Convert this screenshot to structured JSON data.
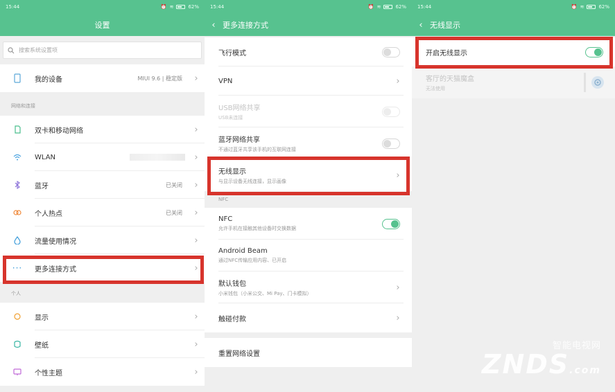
{
  "status": {
    "time": "15:44",
    "battery": "62%"
  },
  "screen1": {
    "title": "设置",
    "search_placeholder": "搜索系统设置项",
    "my_device": {
      "label": "我的设备",
      "value": "MIUI 9.6 | 稳定版"
    },
    "section_network": "网络和连接",
    "network_items": [
      {
        "label": "双卡和移动网络",
        "value": ""
      },
      {
        "label": "WLAN",
        "value": ""
      },
      {
        "label": "蓝牙",
        "value": "已关闭"
      },
      {
        "label": "个人热点",
        "value": "已关闭"
      },
      {
        "label": "流量使用情况",
        "value": ""
      },
      {
        "label": "更多连接方式",
        "value": ""
      }
    ],
    "section_personal": "个人",
    "personal_items": [
      {
        "label": "显示"
      },
      {
        "label": "壁纸"
      },
      {
        "label": "个性主题"
      }
    ]
  },
  "screen2": {
    "title": "更多连接方式",
    "items_top": [
      {
        "title": "飞行模式",
        "sub": ""
      },
      {
        "title": "VPN",
        "sub": ""
      },
      {
        "title": "USB网络共享",
        "sub": "USB未连接"
      },
      {
        "title": "蓝牙网络共享",
        "sub": "不通过蓝牙共享该手机的互联网连接"
      },
      {
        "title": "无线显示",
        "sub": "与显示设备无线连接，显示画像"
      }
    ],
    "section_nfc": "NFC",
    "items_nfc": [
      {
        "title": "NFC",
        "sub": "允许手机在接触其他设备时交换数据"
      },
      {
        "title": "Android Beam",
        "sub": "通过NFC传输应用内容、已开启"
      },
      {
        "title": "默认钱包",
        "sub": "小米钱包（小米公交、Mi Pay、门卡模拟）"
      },
      {
        "title": "触碰付款",
        "sub": ""
      }
    ],
    "reset_label": "重置网络设置"
  },
  "screen3": {
    "title": "无线显示",
    "enable_label": "开启无线显示",
    "device": {
      "name": "客厅的天猫魔盒",
      "status": "无法使用"
    }
  },
  "watermark": {
    "cn": "智能电视网",
    "logo": "ZNDS",
    "suffix": ".com"
  },
  "colors": {
    "accent": "#57c28f",
    "highlight": "#d7342c"
  }
}
